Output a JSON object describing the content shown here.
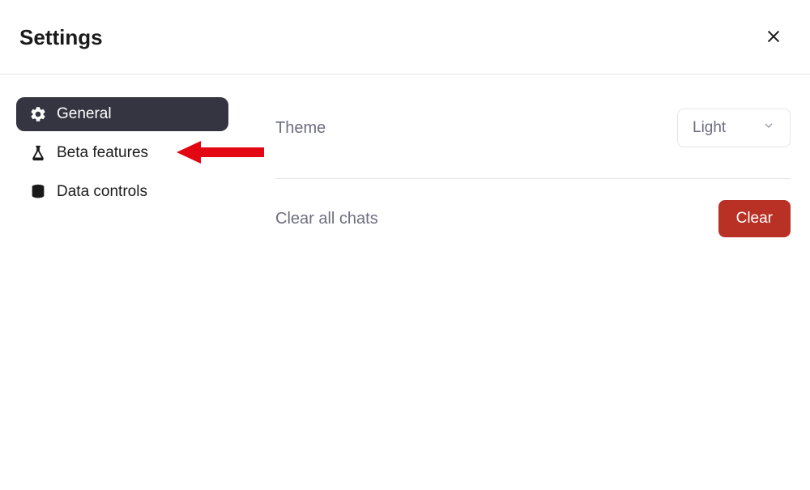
{
  "header": {
    "title": "Settings"
  },
  "sidebar": {
    "items": [
      {
        "label": "General",
        "icon": "gear-icon",
        "active": true
      },
      {
        "label": "Beta features",
        "icon": "flask-icon",
        "active": false
      },
      {
        "label": "Data controls",
        "icon": "database-icon",
        "active": false
      }
    ]
  },
  "main": {
    "theme": {
      "label": "Theme",
      "selected": "Light"
    },
    "clear_chats": {
      "label": "Clear all chats",
      "button": "Clear"
    }
  },
  "annotation": {
    "arrow_color": "#e30613",
    "target": "sidebar-item-beta-features"
  }
}
